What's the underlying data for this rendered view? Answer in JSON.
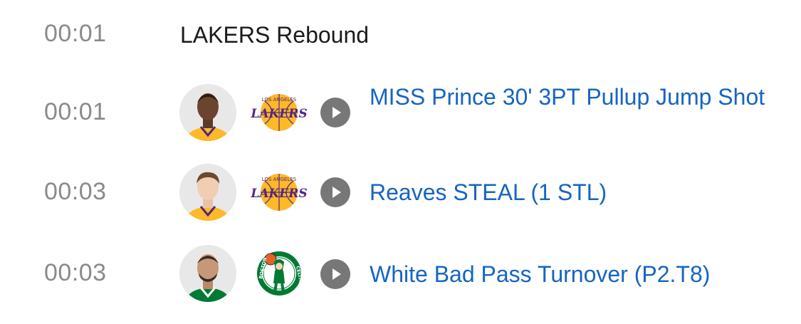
{
  "plays": [
    {
      "time": "00:01",
      "description": "LAKERS Rebound",
      "team": "",
      "player_avatar": "",
      "has_video": false
    },
    {
      "time": "00:01",
      "description": "MISS Prince 30' 3PT Pullup Jump Shot",
      "team": "lakers",
      "player_avatar": "player-avatar-prince",
      "has_video": true
    },
    {
      "time": "00:03",
      "description": "Reaves STEAL (1 STL)",
      "team": "lakers",
      "player_avatar": "player-avatar-reaves",
      "has_video": true
    },
    {
      "time": "00:03",
      "description": "White Bad Pass Turnover (P2.T8)",
      "team": "celtics",
      "player_avatar": "player-avatar-white",
      "has_video": true
    }
  ],
  "logos": {
    "lakers": {
      "wordmark": "LAKERS",
      "arc_text": "LOS ANGELES"
    },
    "celtics": {
      "arc_left": "BOSTON",
      "arc_right": "CELTICS"
    }
  },
  "colors": {
    "time_text": "#8a8a8a",
    "link_text": "#1565c0",
    "plain_text": "#1a1a1a",
    "play_button": "#777777",
    "lakers_purple": "#552583",
    "lakers_gold": "#fdb927",
    "celtics_green": "#007a33"
  }
}
